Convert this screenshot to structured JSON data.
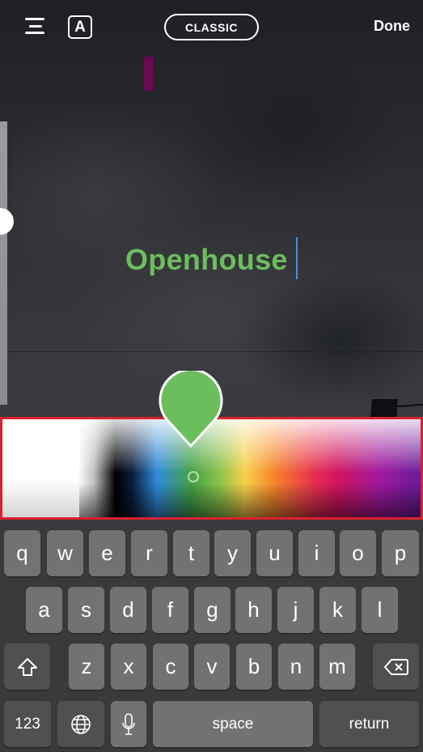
{
  "topbar": {
    "align_icon": "text-align-center-icon",
    "font_icon_label": "A",
    "style_label": "CLASSIC",
    "done_label": "Done"
  },
  "editor": {
    "text": "Openhouse",
    "text_color": "#6cbe5d",
    "caret_color": "#4a90d9",
    "size_slider_value": 0.65
  },
  "color_picker": {
    "selected_color": "#6cbe5d",
    "highlight_border": "#d8222d"
  },
  "keyboard": {
    "row1": [
      "q",
      "w",
      "e",
      "r",
      "t",
      "y",
      "u",
      "i",
      "o",
      "p"
    ],
    "row2": [
      "a",
      "s",
      "d",
      "f",
      "g",
      "h",
      "j",
      "k",
      "l"
    ],
    "row3": [
      "z",
      "x",
      "c",
      "v",
      "b",
      "n",
      "m"
    ],
    "shift_icon": "shift-icon",
    "delete_icon": "backspace-icon",
    "numbers_label": "123",
    "globe_icon": "globe-icon",
    "mic_icon": "microphone-icon",
    "space_label": "space",
    "return_label": "return"
  }
}
